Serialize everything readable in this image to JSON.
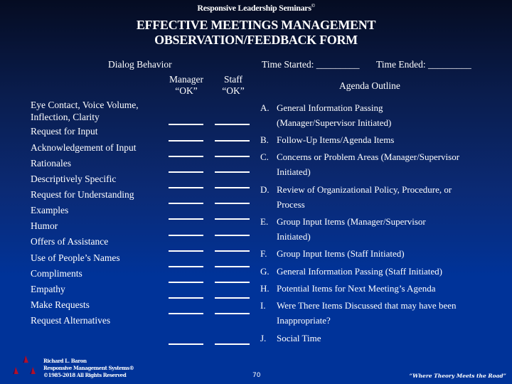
{
  "header": {
    "org": "Responsive Leadership Seminars",
    "org_mark": "©",
    "title_line1": "EFFECTIVE MEETINGS MANAGEMENT",
    "title_line2": "OBSERVATION/FEEDBACK FORM"
  },
  "form": {
    "dialog_behavior_label": "Dialog Behavior",
    "time_started_label": "Time Started: _________",
    "time_ended_label": "Time Ended: _________",
    "manager_ok_line1": "Manager",
    "manager_ok_line2": "“OK”",
    "staff_ok_line1": "Staff",
    "staff_ok_line2": "“OK”",
    "agenda_outline_label": "Agenda Outline"
  },
  "behaviors": [
    "Eye Contact, Voice Volume,",
    "Inflection, Clarity",
    "Request for Input",
    "Acknowledgement of Input",
    "Rationales",
    "Descriptively Specific",
    "Request for Understanding",
    "Examples",
    "Humor",
    "Offers of Assistance",
    "Use of People’s Names",
    "Compliments",
    "Empathy",
    "Make Requests",
    "Request Alternatives"
  ],
  "agenda": [
    {
      "letter": "A.",
      "line1": "General Information Passing",
      "line2": "(Manager/Supervisor Initiated)"
    },
    {
      "letter": "B.",
      "line1": "Follow-Up Items/Agenda Items",
      "line2": ""
    },
    {
      "letter": "C.",
      "line1": "Concerns or Problem Areas (Manager/Supervisor",
      "line2": "Initiated)"
    },
    {
      "letter": "D.",
      "line1": "Review of Organizational Policy, Procedure, or",
      "line2": "Process"
    },
    {
      "letter": "E.",
      "line1": "Group Input Items (Manager/Supervisor",
      "line2": "Initiated)"
    },
    {
      "letter": "F.",
      "line1": "Group Input Items (Staff Initiated)",
      "line2": ""
    },
    {
      "letter": "G.",
      "line1": "General Information Passing (Staff Initiated)",
      "line2": ""
    },
    {
      "letter": "H.",
      "line1": "Potential Items for Next Meeting’s Agenda",
      "line2": ""
    },
    {
      "letter": "I.",
      "line1": "Were There Items Discussed that may have been",
      "line2": "Inappropriate?"
    },
    {
      "letter": "J.",
      "line1": "Social Time",
      "line2": ""
    }
  ],
  "footer": {
    "author": "Richard L. Baron",
    "company": "Responsive Management Systems®",
    "copyright": "©1985-2018 All Rights Reserved",
    "page_number": "70",
    "tagline": "“Where Theory Meets the Road”",
    "logo": "three-triangles-logo",
    "logo_color": "#b0102a"
  }
}
